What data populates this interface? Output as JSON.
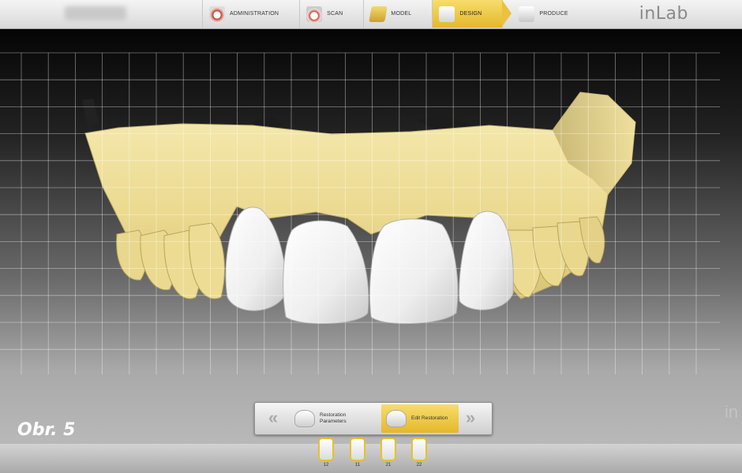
{
  "header": {
    "brand": "inLab",
    "steps": [
      {
        "label": "ADMINISTRATION",
        "icon": "admin-teeth-icon",
        "active": false
      },
      {
        "label": "SCAN",
        "icon": "scan-teeth-icon",
        "active": false
      },
      {
        "label": "MODEL",
        "icon": "model-block-icon",
        "active": false
      },
      {
        "label": "DESIGN",
        "icon": "design-tooth-icon",
        "active": true
      },
      {
        "label": "PRODUCE",
        "icon": "produce-block-icon",
        "active": false
      }
    ]
  },
  "toolbar": {
    "prev_label": "«",
    "next_label": "»",
    "params_label": "Restoration Parameters",
    "edit_label": "Edit Restoration"
  },
  "teeth": [
    {
      "number": "12"
    },
    {
      "number": "11"
    },
    {
      "number": "21"
    },
    {
      "number": "22"
    }
  ],
  "watermark": "in",
  "caption": "Obr. 5",
  "colors": {
    "accent": "#e8c02e",
    "model": "#efe2a0",
    "restoration": "#f2f2f2"
  }
}
